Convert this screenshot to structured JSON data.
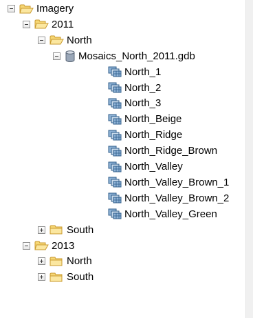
{
  "tree": [
    {
      "label": "Imagery",
      "icon": "open-folder-icon",
      "toggle": "minus",
      "level": 0
    },
    {
      "label": "2011",
      "icon": "open-folder-icon",
      "toggle": "minus",
      "level": 1
    },
    {
      "label": "North",
      "icon": "open-folder-icon",
      "toggle": "minus",
      "level": 2
    },
    {
      "label": "Mosaics_North_2011.gdb",
      "icon": "geodatabase-icon",
      "toggle": "minus",
      "level": 3
    },
    {
      "label": "North_1",
      "icon": "mosaic-dataset-icon",
      "toggle": "none",
      "level": 4
    },
    {
      "label": "North_2",
      "icon": "mosaic-dataset-icon",
      "toggle": "none",
      "level": 4
    },
    {
      "label": "North_3",
      "icon": "mosaic-dataset-icon",
      "toggle": "none",
      "level": 4
    },
    {
      "label": "North_Beige",
      "icon": "mosaic-dataset-icon",
      "toggle": "none",
      "level": 4
    },
    {
      "label": "North_Ridge",
      "icon": "mosaic-dataset-icon",
      "toggle": "none",
      "level": 4
    },
    {
      "label": "North_Ridge_Brown",
      "icon": "mosaic-dataset-icon",
      "toggle": "none",
      "level": 4
    },
    {
      "label": "North_Valley",
      "icon": "mosaic-dataset-icon",
      "toggle": "none",
      "level": 4
    },
    {
      "label": "North_Valley_Brown_1",
      "icon": "mosaic-dataset-icon",
      "toggle": "none",
      "level": 4
    },
    {
      "label": "North_Valley_Brown_2",
      "icon": "mosaic-dataset-icon",
      "toggle": "none",
      "level": 4
    },
    {
      "label": "North_Valley_Green",
      "icon": "mosaic-dataset-icon",
      "toggle": "none",
      "level": 4
    },
    {
      "label": "South",
      "icon": "closed-folder-icon",
      "toggle": "plus",
      "level": 2
    },
    {
      "label": "2013",
      "icon": "open-folder-icon",
      "toggle": "minus",
      "level": 1
    },
    {
      "label": "North",
      "icon": "closed-folder-icon",
      "toggle": "plus",
      "level": 2
    },
    {
      "label": "South",
      "icon": "closed-folder-icon",
      "toggle": "plus",
      "level": 2
    }
  ],
  "colors": {
    "folder_fill": "#f6d775",
    "folder_edge": "#c99a2e",
    "gdb_fill": "#9aa7b8",
    "gdb_edge": "#5a6676",
    "mosaic_dark": "#2f5d8a",
    "mosaic_light": "#8fb3d6"
  }
}
